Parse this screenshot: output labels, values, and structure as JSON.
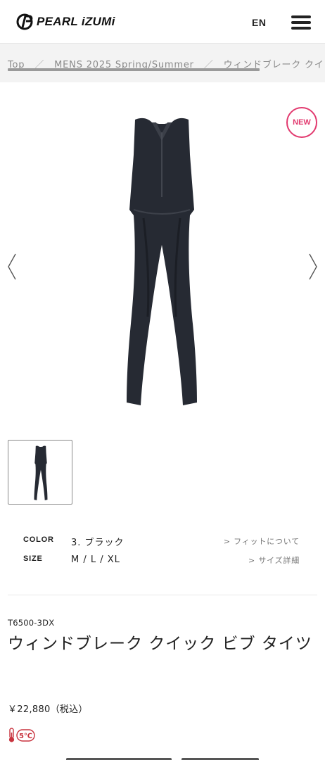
{
  "header": {
    "brand": "PEARL iZUMi",
    "language": "EN",
    "menu_icon": "hamburger-menu-icon"
  },
  "breadcrumb": {
    "items": [
      "Top",
      "MENS 2025 Spring/Summer",
      "ウィンドブレーク クイ"
    ],
    "separator": "／"
  },
  "gallery": {
    "badge": "NEW",
    "prev_icon": "chevron-left-icon",
    "next_icon": "chevron-right-icon",
    "thumbnail_count": 1
  },
  "specs": {
    "color_label": "COLOR",
    "color_value": "3. ブラック",
    "fit_link": "> フィットについて",
    "size_label": "SIZE",
    "size_value": "M / L / XL",
    "size_link": "> サイズ詳細"
  },
  "product": {
    "sku": "T6500-3DX",
    "title": "ウィンドブレーク クイック ビブ タイツ",
    "price": "￥22,880（税込）",
    "temperature": "5℃"
  },
  "colors": {
    "accent": "#e23a6f",
    "text": "#222222",
    "crumb_bg": "#f3f3f3"
  }
}
